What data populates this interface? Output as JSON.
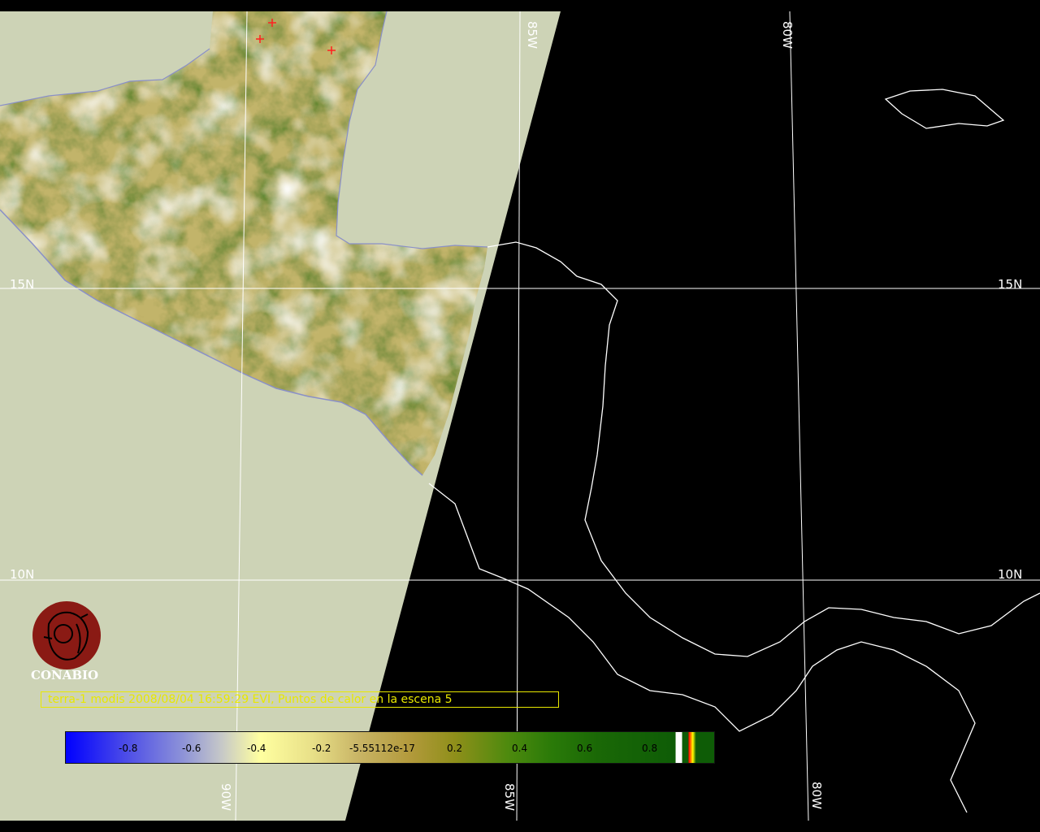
{
  "map": {
    "latitude_labels": [
      "15N",
      "10N"
    ],
    "longitude_labels": [
      "85W",
      "80W",
      "90W"
    ],
    "colors": {
      "background_left": "#cdd3b6",
      "background_right": "#000000",
      "coastline": "#ffffff",
      "grid": "#ffffff"
    }
  },
  "logo": {
    "name": "CONABIO",
    "icon": "conabio-logo-icon"
  },
  "caption": {
    "text": "terra-1 modis 2008/08/04 16:59:29 EVI, Puntos de calor en la escena 5",
    "color": "#e8e800"
  },
  "colorbar": {
    "tick_labels": [
      "-0.8",
      "-0.6",
      "-0.4",
      "-0.2",
      "-5.55112e-17",
      "0.2",
      "0.4",
      "0.6",
      "0.8"
    ]
  }
}
